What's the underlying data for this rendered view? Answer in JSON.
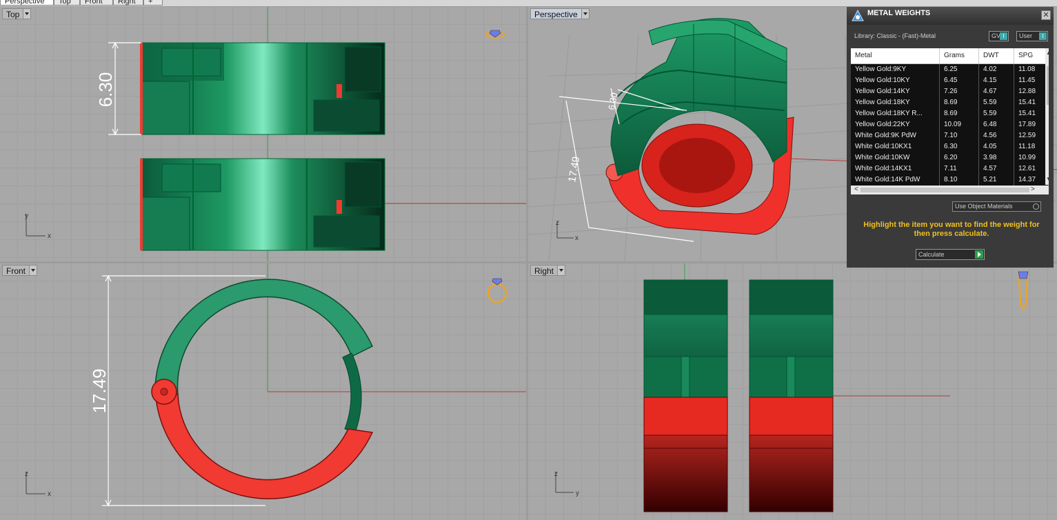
{
  "tabs": [
    "Perspective",
    "Top",
    "Front",
    "Right"
  ],
  "viewports": {
    "top": {
      "name": "Top",
      "dimension": "6.30",
      "axis_y": "y",
      "axis_x": "x"
    },
    "perspective": {
      "name": "Perspective",
      "dim_small": "6.30",
      "dim_large": "17.49",
      "axis_y": "z",
      "axis_x": "x"
    },
    "front": {
      "name": "Front",
      "dimension": "17.49",
      "axis_y": "z",
      "axis_x": "x"
    },
    "right": {
      "name": "Right",
      "axis_y": "z",
      "axis_x": "y"
    }
  },
  "panel": {
    "title": "METAL WEIGHTS",
    "close": "✕",
    "library": "Library: Classic - (Fast)-Metal",
    "gv_label": "GV",
    "user_label": "User",
    "columns": [
      "Metal",
      "Grams",
      "DWT",
      "SPG"
    ],
    "rows": [
      [
        "Yellow Gold:9KY",
        "6.25",
        "4.02",
        "11.08"
      ],
      [
        "Yellow Gold:10KY",
        "6.45",
        "4.15",
        "11.45"
      ],
      [
        "Yellow Gold:14KY",
        "7.26",
        "4.67",
        "12.88"
      ],
      [
        "Yellow Gold:18KY",
        "8.69",
        "5.59",
        "15.41"
      ],
      [
        "Yellow Gold:18KY R...",
        "8.69",
        "5.59",
        "15.41"
      ],
      [
        "Yellow Gold:22KY",
        "10.09",
        "6.48",
        "17.89"
      ],
      [
        "White Gold:9K PdW",
        "7.10",
        "4.56",
        "12.59"
      ],
      [
        "White Gold:10KX1",
        "6.30",
        "4.05",
        "11.18"
      ],
      [
        "White Gold:10KW",
        "6.20",
        "3.98",
        "10.99"
      ],
      [
        "White Gold:14KX1",
        "7.11",
        "4.57",
        "12.61"
      ],
      [
        "White Gold:14K PdW",
        "8.10",
        "5.21",
        "14.37"
      ]
    ],
    "scroll_left": "<",
    "scroll_right": ">",
    "use_object_materials": "Use Object Materials",
    "hint": "Highlight the item you want to find the weight for then press calculate.",
    "calculate": "Calculate"
  },
  "colors": {
    "green": "#1f8a5c",
    "red": "#f03a32",
    "grid": "#9a9a9a",
    "viewport_bg": "#a8a8a8",
    "hint": "#f0c020"
  }
}
